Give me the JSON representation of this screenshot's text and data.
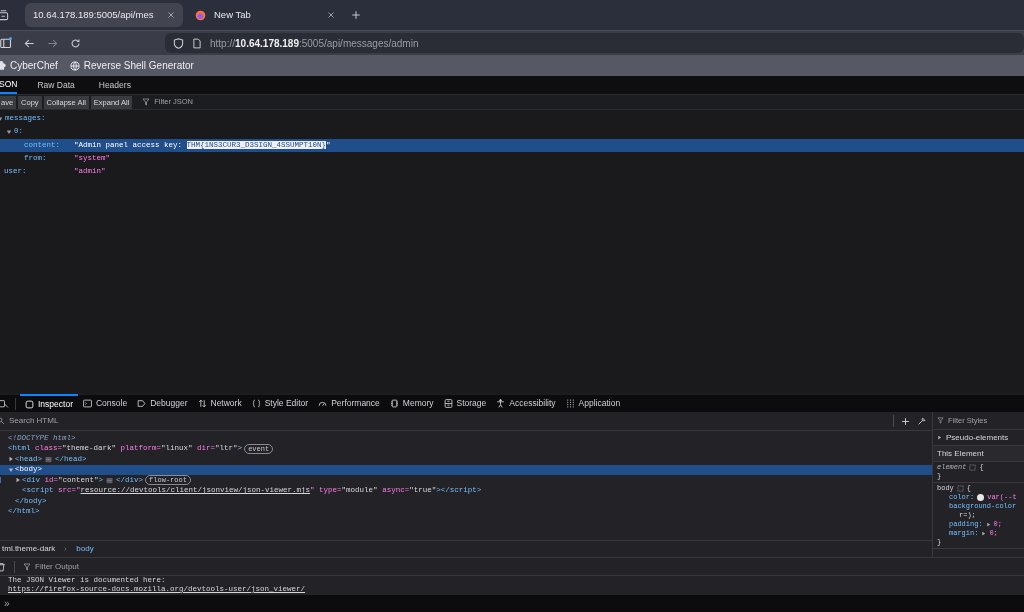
{
  "browser_tabs": [
    {
      "title": "10.64.178.189:5005/api/mes",
      "selected": true
    },
    {
      "title": "New Tab",
      "selected": false
    }
  ],
  "address_bar": {
    "scheme": "http://",
    "host": "10.64.178.189",
    "path": ":5005/api/messages/admin"
  },
  "bookmarks": [
    "CyberChef",
    "Reverse Shell Generator"
  ],
  "viewer_tabs": [
    {
      "label": "SON",
      "selected": true
    },
    {
      "label": "Raw Data",
      "selected": false
    },
    {
      "label": "Headers",
      "selected": false
    }
  ],
  "viewer_toolbar": {
    "buttons": [
      "ave",
      "Copy",
      "Collapse All",
      "Expand All"
    ],
    "filter_placeholder": "Filter JSON"
  },
  "json_tree": [
    {
      "key": "messages:",
      "expanded": true,
      "selected": false,
      "children": [
        {
          "key": "0:",
          "expanded": true,
          "selected": false,
          "children": [
            {
              "key": "content:",
              "selected": true,
              "value": [
                {
                  "text": "\"Admin panel access key: ",
                  "selected_text": false
                },
                {
                  "text": "THM{1NS3CUR3_D3SIGN_4SSUMPT10N}",
                  "selected_text": true
                },
                {
                  "text": "\"",
                  "selected_text": false
                }
              ]
            },
            {
              "key": "from:",
              "selected": false,
              "value": [
                {
                  "text": "\"system\"",
                  "selected_text": false
                }
              ]
            }
          ]
        }
      ]
    },
    {
      "key": "user:",
      "selected": false,
      "value": [
        {
          "text": "\"admin\"",
          "selected_text": false
        }
      ]
    }
  ],
  "devtools_tabs": [
    {
      "label": "Inspector",
      "selected": true
    },
    {
      "label": "Console",
      "selected": false
    },
    {
      "label": "Debugger",
      "selected": false
    },
    {
      "label": "Network",
      "selected": false
    },
    {
      "label": "Style Editor",
      "selected": false
    },
    {
      "label": "Performance",
      "selected": false
    },
    {
      "label": "Memory",
      "selected": false
    },
    {
      "label": "Storage",
      "selected": false
    },
    {
      "label": "Accessibility",
      "selected": false
    },
    {
      "label": "Application",
      "selected": false
    }
  ],
  "inspector": {
    "search_placeholder": "Search HTML",
    "markup": [
      {
        "selected": false,
        "tokens": [
          {
            "kind": "doctype",
            "text": "<!DOCTYPE html>"
          }
        ]
      },
      {
        "selected": false,
        "tokens": [
          {
            "kind": "tag",
            "text": "<html"
          },
          {
            "kind": "attr",
            "text": " class="
          },
          {
            "kind": "value",
            "text": "\"theme-dark\""
          },
          {
            "kind": "attr",
            "text": " platform="
          },
          {
            "kind": "value",
            "text": "\"linux\""
          },
          {
            "kind": "attr",
            "text": " dir="
          },
          {
            "kind": "value",
            "text": "\"ltr\""
          },
          {
            "kind": "tag",
            "text": ">"
          },
          {
            "kind": "badge",
            "text": "event"
          }
        ],
        "children": [
          {
            "selected": false,
            "expanded": false,
            "tokens": [
              {
                "kind": "tag",
                "text": "<head>"
              },
              {
                "kind": "more"
              },
              {
                "kind": "tag",
                "text": "</head>"
              }
            ]
          },
          {
            "selected": true,
            "expanded": true,
            "tokens": [
              {
                "kind": "tag",
                "text": "<body>"
              }
            ],
            "children": [
              {
                "selected": false,
                "expanded": false,
                "tokens": [
                  {
                    "kind": "tag",
                    "text": "<div"
                  },
                  {
                    "kind": "attr",
                    "text": " id="
                  },
                  {
                    "kind": "value",
                    "text": "\"content\""
                  },
                  {
                    "kind": "tag",
                    "text": ">"
                  },
                  {
                    "kind": "more"
                  },
                  {
                    "kind": "tag",
                    "text": "</div>"
                  },
                  {
                    "kind": "badge",
                    "text": "flow-root"
                  }
                ]
              },
              {
                "selected": false,
                "tokens": [
                  {
                    "kind": "tag",
                    "text": "<script"
                  },
                  {
                    "kind": "attr",
                    "text": " src=\""
                  },
                  {
                    "kind": "link",
                    "text": "resource://devtools/client/jsonview/json-viewer.mjs"
                  },
                  {
                    "kind": "attr",
                    "text": "\""
                  },
                  {
                    "kind": "attr",
                    "text": " type="
                  },
                  {
                    "kind": "value",
                    "text": "\"module\""
                  },
                  {
                    "kind": "attr",
                    "text": " async="
                  },
                  {
                    "kind": "value",
                    "text": "\"true\""
                  },
                  {
                    "kind": "tag",
                    "text": "></script>"
                  }
                ]
              }
            ],
            "close": [
              {
                "kind": "tag",
                "text": "</body>"
              }
            ]
          }
        ],
        "close": [
          {
            "kind": "tag",
            "text": "</html>"
          }
        ]
      }
    ],
    "breadcrumbs": [
      {
        "label": "tml.theme-dark",
        "selected": false
      },
      {
        "label": "body",
        "selected": true
      }
    ]
  },
  "rules_sidebar": {
    "filter_placeholder": "Filter Styles",
    "pseudo_elements": "Pseudo-elements",
    "section_title": "This Element",
    "rules": [
      {
        "selector": "element",
        "open": "{",
        "close": "}"
      },
      {
        "selector": "body",
        "open": "{",
        "declarations": [
          {
            "property": "color:",
            "value": "var(--t",
            "swatch": true
          },
          {
            "property": "background-color",
            "continuation": "r=);"
          },
          {
            "property": "padding:",
            "value": "0;",
            "expandable": true
          },
          {
            "property": "margin:",
            "value": "0;",
            "expandable": true
          }
        ],
        "close": "}"
      }
    ]
  },
  "console": {
    "filter_placeholder": "Filter Output",
    "messages": [
      {
        "kind": "text",
        "text": "The JSON Viewer is documented here:"
      },
      {
        "kind": "link",
        "text": "https://firefox-source-docs.mozilla.org/devtools-user/json_viewer/"
      }
    ],
    "prompt": "»"
  }
}
